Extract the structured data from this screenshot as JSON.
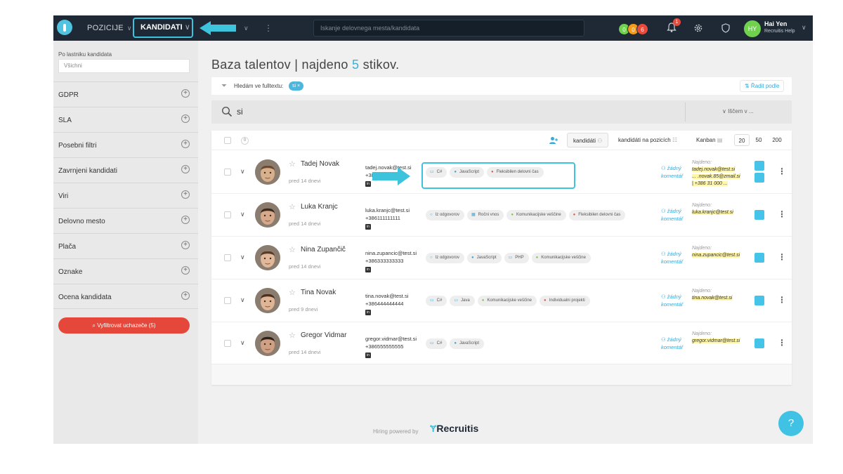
{
  "topbar": {
    "nav_positions": "POZICIJE",
    "nav_candidates": "KANDIDATI",
    "nav_dots": "⋮",
    "search_placeholder": "Iskanje delovnega mesta/kandidata",
    "counters": [
      {
        "value": "0",
        "color": "#6fd14e"
      },
      {
        "value": "0",
        "color": "#f59c1a"
      },
      {
        "value": "6",
        "color": "#e84b3c"
      }
    ],
    "bell_badge": "1",
    "avatar_initials": "HY",
    "user_name": "Hai Yen",
    "user_subtitle": "Recruitis Help"
  },
  "sidebar": {
    "owner_label": "Po lastniku kandidata",
    "owner_value": "Všichni",
    "sections": [
      "GDPR",
      "SLA",
      "Posebni filtri",
      "Zavrnjeni kandidati",
      "Viri",
      "Delovno mesto",
      "Plača",
      "Oznake",
      "Ocena kandidata"
    ],
    "filter_button": "Vyfiltrovat uchazeče (5)"
  },
  "main": {
    "title_prefix": "Baza talentov | najdeno ",
    "title_count": "5",
    "title_suffix": " stikov.",
    "fulltext_label": "Hledám ve fulltextu:",
    "fulltext_chip": "si ×",
    "sort_button": "⇅ Řadit podle",
    "search_query": "si",
    "search_in": "∨ Iščem v ..."
  },
  "list_header": {
    "selected_count": "0",
    "view_candidates": "kandidáti",
    "view_positions": "kandidáti na pozicích",
    "view_kanban": "Kanban",
    "page_sizes": [
      "20",
      "50",
      "200"
    ]
  },
  "common": {
    "comment_line1": "žádný",
    "comment_line2": "komentář",
    "found_label": "Najdeno:",
    "linkedin": "in"
  },
  "candidates": [
    {
      "name": "Tadej Novak",
      "ago": "pred 14 dnevi",
      "email": "tadej.novak@test.si",
      "phone": "+38",
      "tags": [
        {
          "icon": "monitor-icon",
          "label": "C#"
        },
        {
          "icon": "person-icon",
          "label": "JavaScript"
        },
        {
          "icon": "person-red-icon",
          "label": "Fleksibilen delovni čas"
        }
      ],
      "found": [
        "tadej.novak@test.si",
        "... .novak.85@zmail.si",
        "| +386 31 000 ..."
      ]
    },
    {
      "name": "Luka Kranjc",
      "ago": "pred 14 dnevi",
      "email": "luka.kranjc@test.si",
      "phone": "+386111111111",
      "tags": [
        {
          "icon": "chat-icon",
          "label": "Iz odgovorov"
        },
        {
          "icon": "calendar-icon",
          "label": "Ročni vnos"
        },
        {
          "icon": "dot-icon",
          "label": "Komunikacijske veščine"
        },
        {
          "icon": "person-red-icon",
          "label": "Fleksibilen delovni čas"
        }
      ],
      "found": [
        "luka.kranjc@test.si"
      ]
    },
    {
      "name": "Nina Zupančič",
      "ago": "pred 14 dnevi",
      "email": "nina.zupancic@test.si",
      "phone": "+386333333333",
      "tags": [
        {
          "icon": "chat-icon",
          "label": "Iz odgovorov"
        },
        {
          "icon": "person-icon",
          "label": "JavaScript"
        },
        {
          "icon": "monitor-icon",
          "label": "PHP"
        },
        {
          "icon": "dot-icon",
          "label": "Komunikacijske veščine"
        }
      ],
      "found": [
        "nina.zupancic@test.si"
      ]
    },
    {
      "name": "Tina Novak",
      "ago": "pred 9 dnevi",
      "email": "tina.novak@test.si",
      "phone": "+386444444444",
      "tags": [
        {
          "icon": "monitor-icon",
          "label": "C#"
        },
        {
          "icon": "monitor-icon",
          "label": "Java"
        },
        {
          "icon": "dot-icon",
          "label": "Komunikacijske veščine"
        },
        {
          "icon": "person-red-icon",
          "label": "Individualni projekti"
        }
      ],
      "found": [
        "tina.novak@test.si"
      ]
    },
    {
      "name": "Gregor Vidmar",
      "ago": "pred 14 dnevi",
      "email": "gregor.vidmar@test.si",
      "phone": "+386555555555",
      "tags": [
        {
          "icon": "monitor-icon",
          "label": "C#"
        },
        {
          "icon": "person-icon",
          "label": "JavaScript"
        }
      ],
      "found": [
        "gregor.vidmar@test.si"
      ]
    }
  ],
  "footer": {
    "powered": "Hiring powered by",
    "brand": "Recruitis",
    "help": "?"
  },
  "colors": {
    "accent": "#3ec3dd",
    "topbar": "#1e2935",
    "danger": "#e5483a"
  }
}
